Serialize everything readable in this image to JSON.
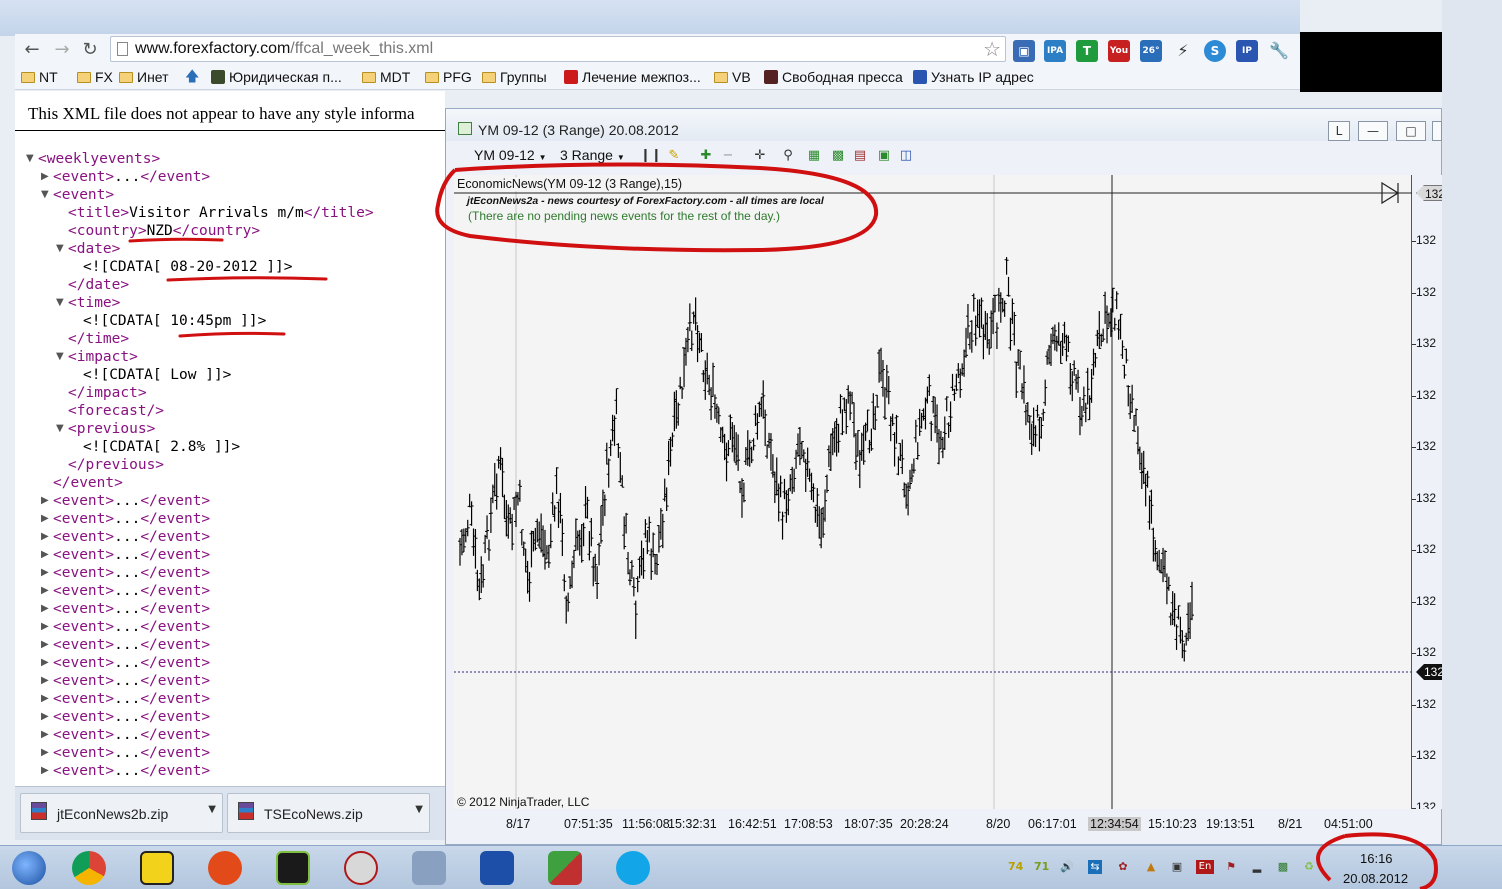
{
  "browser": {
    "url_host": "www.forexfactory.com",
    "url_path": "/ffcal_week_this.xml",
    "bookmarks": [
      "NT",
      "FX",
      "Инет",
      "Юридическая п...",
      "MDT",
      "PFG",
      "Группы",
      "Лечение межпоз...",
      "VB",
      "Свободная пресса",
      "Узнать IP адрес"
    ],
    "extensions": {
      "ipa_label": "IPA",
      "t_label": "T",
      "youtube_label": "You",
      "weather_label": "26°",
      "ip_label": "IP"
    }
  },
  "xml_page": {
    "note": "This XML file does not appear to have any style informa",
    "lines": [
      {
        "indent": 0,
        "tri": "▼",
        "tag": "<weeklyevents>",
        "text": "",
        "close": ""
      },
      {
        "indent": 1,
        "tri": "▶",
        "tag": "<event>",
        "text": "...",
        "close": "</event>"
      },
      {
        "indent": 1,
        "tri": "▼",
        "tag": "<event>",
        "text": "",
        "close": ""
      },
      {
        "indent": 2,
        "tri": "",
        "tag": "<title>",
        "text": "Visitor Arrivals m/m",
        "close": "</title>"
      },
      {
        "indent": 2,
        "tri": "",
        "tag": "<country>",
        "text": "NZD",
        "close": "</country>"
      },
      {
        "indent": 2,
        "tri": "▼",
        "tag": "<date>",
        "text": "",
        "close": ""
      },
      {
        "indent": 3,
        "tri": "",
        "tag": "",
        "text": "<![CDATA[ 08-20-2012 ]]>",
        "close": ""
      },
      {
        "indent": 2,
        "tri": "",
        "tag": "</date>",
        "text": "",
        "close": ""
      },
      {
        "indent": 2,
        "tri": "▼",
        "tag": "<time>",
        "text": "",
        "close": ""
      },
      {
        "indent": 3,
        "tri": "",
        "tag": "",
        "text": "<![CDATA[ 10:45pm ]]>",
        "close": ""
      },
      {
        "indent": 2,
        "tri": "",
        "tag": "</time>",
        "text": "",
        "close": ""
      },
      {
        "indent": 2,
        "tri": "▼",
        "tag": "<impact>",
        "text": "",
        "close": ""
      },
      {
        "indent": 3,
        "tri": "",
        "tag": "",
        "text": "<![CDATA[ Low ]]>",
        "close": ""
      },
      {
        "indent": 2,
        "tri": "",
        "tag": "</impact>",
        "text": "",
        "close": ""
      },
      {
        "indent": 2,
        "tri": "",
        "tag": "<forecast/>",
        "text": "",
        "close": ""
      },
      {
        "indent": 2,
        "tri": "▼",
        "tag": "<previous>",
        "text": "",
        "close": ""
      },
      {
        "indent": 3,
        "tri": "",
        "tag": "",
        "text": "<![CDATA[ 2.8% ]]>",
        "close": ""
      },
      {
        "indent": 2,
        "tri": "",
        "tag": "</previous>",
        "text": "",
        "close": ""
      },
      {
        "indent": 1,
        "tri": "",
        "tag": "</event>",
        "text": "",
        "close": ""
      },
      {
        "indent": 1,
        "tri": "▶",
        "tag": "<event>",
        "text": "...",
        "close": "</event>"
      },
      {
        "indent": 1,
        "tri": "▶",
        "tag": "<event>",
        "text": "...",
        "close": "</event>"
      },
      {
        "indent": 1,
        "tri": "▶",
        "tag": "<event>",
        "text": "...",
        "close": "</event>"
      },
      {
        "indent": 1,
        "tri": "▶",
        "tag": "<event>",
        "text": "...",
        "close": "</event>"
      },
      {
        "indent": 1,
        "tri": "▶",
        "tag": "<event>",
        "text": "...",
        "close": "</event>"
      },
      {
        "indent": 1,
        "tri": "▶",
        "tag": "<event>",
        "text": "...",
        "close": "</event>"
      },
      {
        "indent": 1,
        "tri": "▶",
        "tag": "<event>",
        "text": "...",
        "close": "</event>"
      },
      {
        "indent": 1,
        "tri": "▶",
        "tag": "<event>",
        "text": "...",
        "close": "</event>"
      },
      {
        "indent": 1,
        "tri": "▶",
        "tag": "<event>",
        "text": "...",
        "close": "</event>"
      },
      {
        "indent": 1,
        "tri": "▶",
        "tag": "<event>",
        "text": "...",
        "close": "</event>"
      },
      {
        "indent": 1,
        "tri": "▶",
        "tag": "<event>",
        "text": "...",
        "close": "</event>"
      },
      {
        "indent": 1,
        "tri": "▶",
        "tag": "<event>",
        "text": "...",
        "close": "</event>"
      },
      {
        "indent": 1,
        "tri": "▶",
        "tag": "<event>",
        "text": "...",
        "close": "</event>"
      },
      {
        "indent": 1,
        "tri": "▶",
        "tag": "<event>",
        "text": "...",
        "close": "</event>"
      },
      {
        "indent": 1,
        "tri": "▶",
        "tag": "<event>",
        "text": "...",
        "close": "</event>"
      },
      {
        "indent": 1,
        "tri": "▶",
        "tag": "<event>",
        "text": "...",
        "close": "</event>"
      }
    ]
  },
  "downloads": [
    {
      "name": "jtEconNews2b.zip"
    },
    {
      "name": "TSEcoNews.zip"
    }
  ],
  "chart_window": {
    "title": "YM 09-12 (3 Range)  20.08.2012",
    "btn_l": "L",
    "instrument": "YM 09-12",
    "period": "3 Range",
    "indicator_label": "EconomicNews(YM 09-12 (3 Range),15)",
    "news_title": "jtEconNews2a - news courtesy of ForexFactory.com - all times are local",
    "news_text": "(There are no pending news events for the rest of the day.)",
    "copyright": "© 2012 NinjaTrader, LLC",
    "price_badge": "132",
    "last_badge": "132"
  },
  "chart_data": {
    "type": "bar",
    "instrument": "YM 09-12",
    "period": "3 Range",
    "y_tick_labels": [
      "132",
      "132",
      "132",
      "132",
      "132",
      "132",
      "132",
      "132",
      "132",
      "132",
      "132",
      "132"
    ],
    "x_tick_labels": [
      "8/17",
      "07:51:35",
      "11:56:08",
      "15:32:31",
      "16:42:51",
      "17:08:53",
      "18:07:35",
      "20:28:24",
      "8/20",
      "06:17:01",
      "12:34:54",
      "15:10:23",
      "19:13:51",
      "8/21",
      "04:51:00"
    ],
    "highlighted_x_label": "12:34:54",
    "price_path": [
      0.62,
      0.55,
      0.7,
      0.58,
      0.45,
      0.6,
      0.52,
      0.68,
      0.57,
      0.63,
      0.5,
      0.72,
      0.6,
      0.55,
      0.66,
      0.48,
      0.38,
      0.6,
      0.74,
      0.58,
      0.65,
      0.52,
      0.4,
      0.3,
      0.18,
      0.28,
      0.35,
      0.45,
      0.4,
      0.5,
      0.42,
      0.36,
      0.46,
      0.55,
      0.48,
      0.4,
      0.52,
      0.58,
      0.44,
      0.38,
      0.33,
      0.48,
      0.4,
      0.3,
      0.36,
      0.45,
      0.5,
      0.4,
      0.35,
      0.42,
      0.38,
      0.3,
      0.24,
      0.18,
      0.26,
      0.2,
      0.14,
      0.28,
      0.36,
      0.42,
      0.32,
      0.22,
      0.26,
      0.3,
      0.38,
      0.28,
      0.22,
      0.17,
      0.26,
      0.36,
      0.46,
      0.58,
      0.66,
      0.72,
      0.78,
      0.7
    ]
  },
  "taskbar": {
    "tray_temp1": "74",
    "tray_temp2": "71",
    "lang": "En",
    "clock_time": "16:16",
    "clock_date": "20.08.2012"
  },
  "colors": {
    "xml_tag": "#881280",
    "annotation_red": "#d01010",
    "news_green": "#2f7a2f"
  }
}
